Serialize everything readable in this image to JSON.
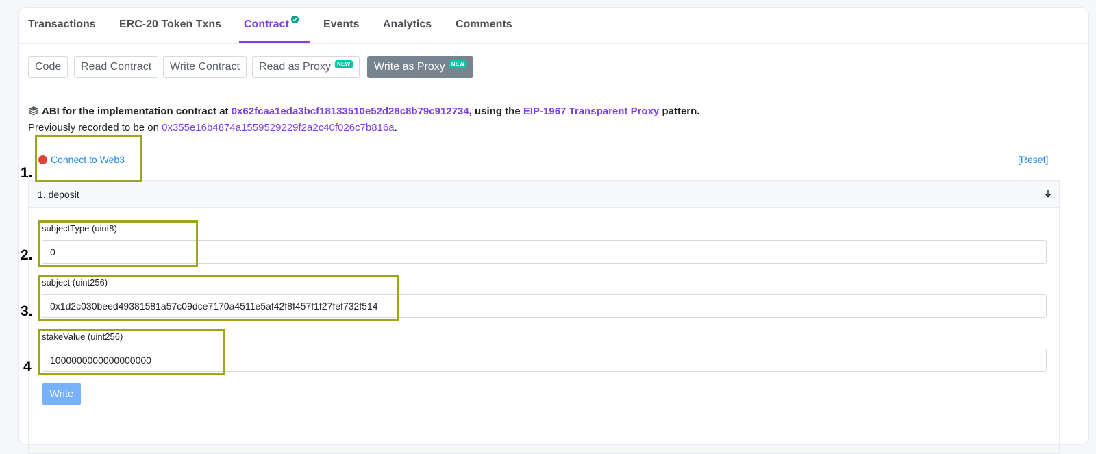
{
  "tabs": [
    {
      "label": "Transactions"
    },
    {
      "label": "ERC-20 Token Txns"
    },
    {
      "label": "Contract",
      "verified": true
    },
    {
      "label": "Events"
    },
    {
      "label": "Analytics"
    },
    {
      "label": "Comments"
    }
  ],
  "subtabs": {
    "code": "Code",
    "read_contract": "Read Contract",
    "write_contract": "Write Contract",
    "read_as_proxy": "Read as Proxy",
    "write_as_proxy": "Write as Proxy",
    "new_badge": "NEW"
  },
  "abi": {
    "prefix": "ABI for the implementation contract at ",
    "impl_address": "0x62fcaa1eda3bcf18133510e52d28c8b79c912734",
    "middle": ", using the ",
    "pattern": "EIP-1967 Transparent Proxy",
    "suffix": " pattern."
  },
  "previous": {
    "prefix": "Previously recorded to be on ",
    "address": "0x355e16b4874a1559529229f2a2c40f026c7b816a",
    "suffix": "."
  },
  "connect_label": "Connect to Web3",
  "reset_label": "[Reset]",
  "function": {
    "title": "1. deposit",
    "fields": [
      {
        "label": "subjectType (uint8)",
        "value": "0"
      },
      {
        "label": "subject (uint256)",
        "value": "0x1d2c030beed49381581a57c09dce7170a4511e5af42f8f457f1f27fef732f514"
      },
      {
        "label": "stakeValue (uint256)",
        "value": "1000000000000000000"
      }
    ],
    "write_label": "Write"
  },
  "annotations": [
    "1.",
    "2.",
    "3.",
    "4"
  ],
  "colors": {
    "accent": "#7b3fe4",
    "link": "#1e88e5",
    "highlight": "#9ea41b",
    "badge": "#00c9a7"
  }
}
